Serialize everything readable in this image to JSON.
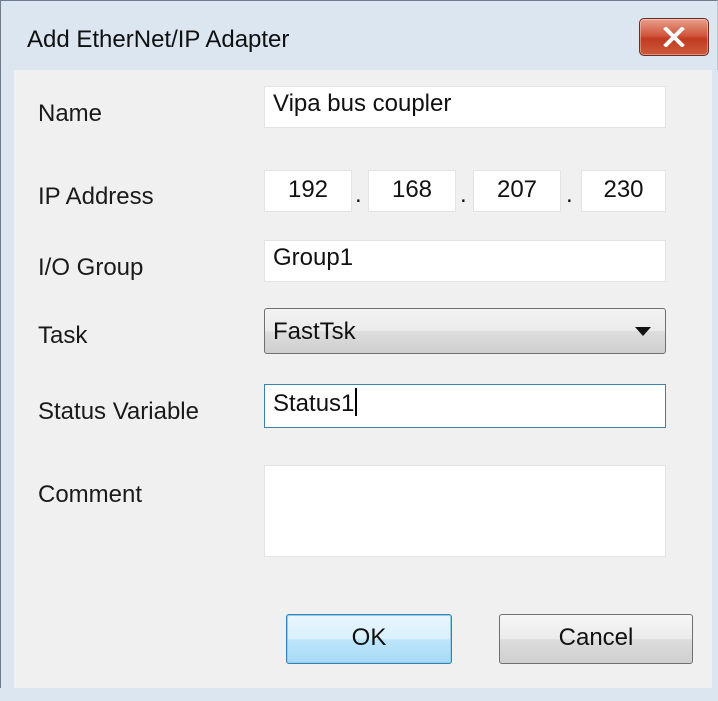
{
  "window": {
    "title": "Add EtherNet/IP Adapter",
    "close_icon": "close-icon",
    "colors": {
      "title_bg": "#dce6f1",
      "close_button": "#c13b21",
      "client_bg": "#f0f0f0",
      "focus_border": "#3c7fb1"
    }
  },
  "form": {
    "name": {
      "label": "Name",
      "value": "Vipa bus coupler"
    },
    "ip": {
      "label": "IP Address",
      "octets": [
        "192",
        "168",
        "207",
        "230"
      ],
      "separator": "."
    },
    "io_group": {
      "label": "I/O Group",
      "value": "Group1"
    },
    "task": {
      "label": "Task",
      "selected": "FastTsk",
      "arrow_icon": "dropdown-arrow-icon"
    },
    "status_variable": {
      "label": "Status Variable",
      "value": "Status1"
    },
    "comment": {
      "label": "Comment",
      "value": ""
    }
  },
  "buttons": {
    "ok": "OK",
    "cancel": "Cancel"
  }
}
